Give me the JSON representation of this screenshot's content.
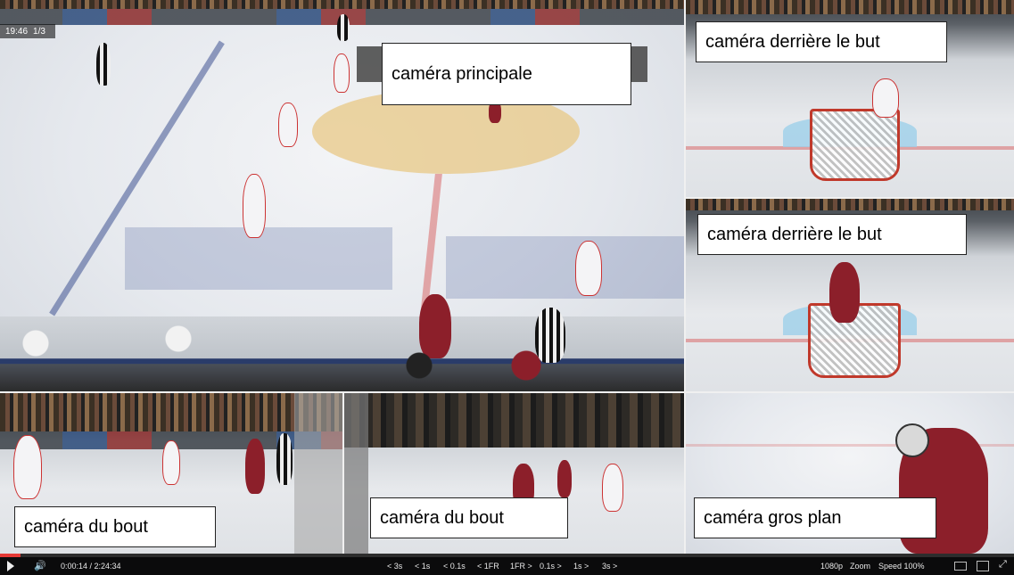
{
  "overlay": {
    "time": "19:46",
    "page": "1/3"
  },
  "labels": {
    "main": "caméra principale",
    "behind_goal_1": "caméra derrière le but",
    "behind_goal_2": "caméra derrière le but",
    "end_1": "caméra du bout",
    "end_2": "caméra du bout",
    "closeup": "caméra gros plan"
  },
  "controls": {
    "play_icon": "play-icon",
    "volume_icon": "volume-icon",
    "time": "0:00:14 / 2:24:34",
    "seek": [
      "< 3s",
      "< 1s",
      "< 0.1s",
      "< 1FR",
      "1FR >",
      "0.1s >",
      "1s >",
      "3s >"
    ],
    "quality": "1080p",
    "zoom": "Zoom",
    "speed": "Speed 100%"
  },
  "playback_progress": 0.002,
  "colors": {
    "home_jersey": "#8c1f2a",
    "away_jersey": "#f4f4f6",
    "ice": "#e6e9ee",
    "bar": "#0b0b0c"
  }
}
